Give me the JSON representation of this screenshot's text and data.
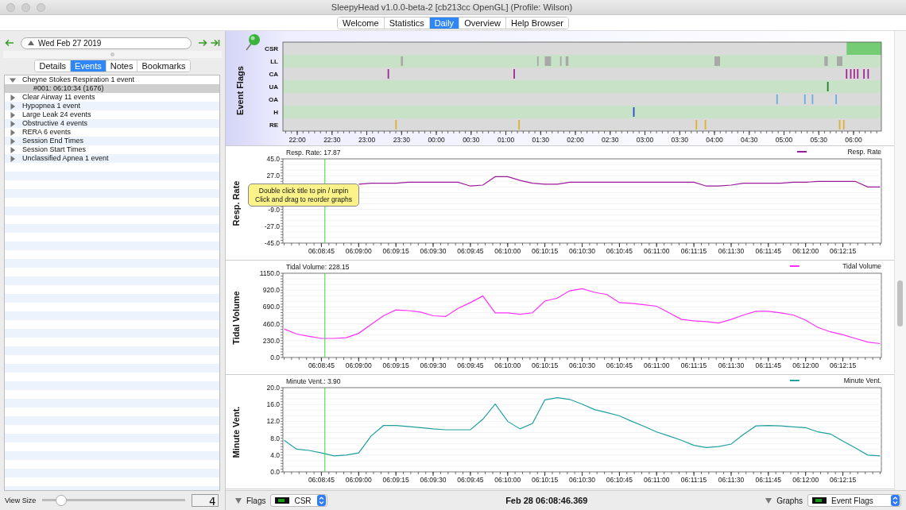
{
  "window": {
    "title": "SleepyHead v1.0.0-beta-2 [cb213cc OpenGL] (Profile: Wilson)"
  },
  "tabs": [
    {
      "label": "Welcome",
      "selected": false
    },
    {
      "label": "Statistics",
      "selected": false
    },
    {
      "label": "Daily",
      "selected": true
    },
    {
      "label": "Overview",
      "selected": false
    },
    {
      "label": "Help Browser",
      "selected": false
    }
  ],
  "sidebar": {
    "date": "Wed Feb 27 2019",
    "tabs": [
      {
        "label": "Details",
        "selected": false
      },
      {
        "label": "Events",
        "selected": true
      },
      {
        "label": "Notes",
        "selected": false
      },
      {
        "label": "Bookmarks",
        "selected": false
      }
    ],
    "events": [
      {
        "label": "Cheyne Stokes Respiration 1 event",
        "expanded": true,
        "children": [
          {
            "label": "#001: 06:10:34 (1676)",
            "selected": true
          }
        ]
      },
      {
        "label": "Clear Airway 11 events",
        "expanded": false
      },
      {
        "label": "Hypopnea 1 event",
        "expanded": false
      },
      {
        "label": "Large Leak 24 events",
        "expanded": false
      },
      {
        "label": "Obstructive 4 events",
        "expanded": false
      },
      {
        "label": "RERA 6 events",
        "expanded": false
      },
      {
        "label": "Session End Times",
        "expanded": false
      },
      {
        "label": "Session Start Times",
        "expanded": false
      },
      {
        "label": "Unclassified Apnea 1 event",
        "expanded": false
      }
    ],
    "view_size": {
      "label": "View Size",
      "level": 0.13,
      "value": "4"
    }
  },
  "graphs": [
    {
      "kind": "flags",
      "title": "Event Flags",
      "rows": [
        {
          "name": "CSR",
          "color": "#74cc74"
        },
        {
          "name": "LL",
          "color": "#a8a8a8"
        },
        {
          "name": "CA",
          "color": "#9c2a90"
        },
        {
          "name": "UA",
          "color": "#2a7a2a"
        },
        {
          "name": "OA",
          "color": "#66aee0"
        },
        {
          "name": "H",
          "color": "#2848d0"
        },
        {
          "name": "RE",
          "color": "#e0b030"
        }
      ],
      "time_labels": [
        "22:00",
        "22:30",
        "23:00",
        "23:30",
        "00:00",
        "00:30",
        "01:00",
        "01:30",
        "02:00",
        "02:30",
        "03:00",
        "03:30",
        "04:00",
        "04:30",
        "05:00",
        "05:30",
        "06:00"
      ]
    },
    {
      "kind": "line",
      "readout": "Resp. Rate: 17.87",
      "tooltip": [
        "Double click title to pin / unpin",
        "Click and drag to reorder graphs"
      ],
      "chart_data": {
        "type": "line",
        "ylabel": "Resp. Rate",
        "ylim": [
          -45,
          45
        ],
        "grid": true,
        "yticks": [
          {
            "value": 45,
            "label": "45.0"
          },
          {
            "value": 27,
            "label": "27.0"
          },
          {
            "value": -9,
            "label": "-9.0"
          },
          {
            "value": -27,
            "label": "-27.0"
          },
          {
            "value": -45,
            "label": "-45.0"
          }
        ],
        "categories": [
          null,
          null,
          null,
          "06:08:45",
          null,
          null,
          "06:09:00",
          null,
          null,
          "06:09:15",
          null,
          null,
          "06:09:30",
          null,
          null,
          "06:09:45",
          null,
          null,
          "06:10:00",
          null,
          null,
          "06:10:15",
          null,
          null,
          "06:10:30",
          null,
          null,
          "06:10:45",
          null,
          null,
          "06:11:00",
          null,
          null,
          "06:11:15",
          null,
          null,
          "06:11:30",
          null,
          null,
          "06:11:45",
          null,
          null,
          "06:12:00",
          null,
          null,
          "06:12:15",
          null,
          null,
          null
        ],
        "series": [
          {
            "name": "Resp. Rate",
            "color": "#9c1a9c",
            "values": [
              null,
              null,
              null,
              null,
              null,
              null,
              18,
              19,
              19,
              19,
              20,
              20,
              20,
              20,
              20,
              16,
              17,
              26,
              26,
              22,
              19,
              18,
              18,
              20,
              20,
              20,
              20,
              20,
              20,
              20,
              20,
              20,
              20,
              20,
              16,
              16,
              17,
              19,
              19,
              19,
              19,
              20,
              20,
              21,
              21,
              21,
              21,
              15,
              15
            ]
          }
        ]
      }
    },
    {
      "kind": "line",
      "readout": "Tidal Volume: 228.15",
      "chart_data": {
        "type": "line",
        "ylabel": "Tidal Volume",
        "ylim": [
          0,
          1150
        ],
        "grid": true,
        "yticks": [
          {
            "value": 1150,
            "label": "1150.0"
          },
          {
            "value": 920,
            "label": "920.0"
          },
          {
            "value": 690,
            "label": "690.0"
          },
          {
            "value": 460,
            "label": "460.0"
          },
          {
            "value": 230,
            "label": "230.0"
          },
          {
            "value": 0,
            "label": "0.0"
          }
        ],
        "categories": [
          null,
          null,
          null,
          "06:08:45",
          null,
          null,
          "06:09:00",
          null,
          null,
          "06:09:15",
          null,
          null,
          "06:09:30",
          null,
          null,
          "06:09:45",
          null,
          null,
          "06:10:00",
          null,
          null,
          "06:10:15",
          null,
          null,
          "06:10:30",
          null,
          null,
          "06:10:45",
          null,
          null,
          "06:11:00",
          null,
          null,
          "06:11:15",
          null,
          null,
          "06:11:30",
          null,
          null,
          "06:11:45",
          null,
          null,
          "06:12:00",
          null,
          null,
          "06:12:15",
          null,
          null,
          null
        ],
        "series": [
          {
            "name": "Tidal Volume",
            "color": "#ff30ff",
            "values": [
              390,
              320,
              290,
              260,
              260,
              270,
              330,
              450,
              570,
              650,
              640,
              620,
              570,
              560,
              670,
              750,
              840,
              610,
              610,
              590,
              610,
              770,
              810,
              910,
              940,
              890,
              860,
              750,
              740,
              720,
              700,
              610,
              520,
              500,
              490,
              470,
              520,
              580,
              630,
              630,
              610,
              580,
              510,
              410,
              350,
              310,
              260,
              210,
              190
            ]
          }
        ]
      }
    },
    {
      "kind": "line",
      "readout": "Minute Vent.: 3.90",
      "chart_data": {
        "type": "line",
        "ylabel": "Minute Vent.",
        "ylim": [
          0,
          20
        ],
        "grid": true,
        "yticks": [
          {
            "value": 20,
            "label": "20.0"
          },
          {
            "value": 16,
            "label": "16.0"
          },
          {
            "value": 12,
            "label": "12.0"
          },
          {
            "value": 8,
            "label": "8.0"
          },
          {
            "value": 4,
            "label": "4.0"
          },
          {
            "value": 0,
            "label": "0.0"
          }
        ],
        "categories": [
          null,
          null,
          null,
          "06:08:45",
          null,
          null,
          "06:09:00",
          null,
          null,
          "06:09:15",
          null,
          null,
          "06:09:30",
          null,
          null,
          "06:09:45",
          null,
          null,
          "06:10:00",
          null,
          null,
          "06:10:15",
          null,
          null,
          "06:10:30",
          null,
          null,
          "06:10:45",
          null,
          null,
          "06:11:00",
          null,
          null,
          "06:11:15",
          null,
          null,
          "06:11:30",
          null,
          null,
          "06:11:45",
          null,
          null,
          "06:12:00",
          null,
          null,
          "06:12:15",
          null,
          null,
          null
        ],
        "series": [
          {
            "name": "Minute Vent.",
            "color": "#20a0a0",
            "values": [
              7.5,
              5.4,
              5.1,
              4.5,
              3.8,
              4,
              4.5,
              8.5,
              11,
              11,
              10.8,
              10.5,
              10.2,
              10,
              10,
              10,
              12.5,
              16.1,
              12,
              10.2,
              11.5,
              17.1,
              17.6,
              17.2,
              16.1,
              14.8,
              14.1,
              13.3,
              12,
              10.8,
              9.5,
              8.5,
              7.5,
              6.3,
              5.8,
              6,
              6.6,
              8.9,
              10.9,
              11,
              10.9,
              10.7,
              10.5,
              9.5,
              9,
              7.3,
              5.7,
              4,
              3.8
            ]
          }
        ]
      }
    }
  ],
  "bottom_bar": {
    "flags_label": "Flags",
    "flags_value": "CSR",
    "time": "Feb 28 06:08:46.369",
    "graphs_label": "Graphs",
    "graphs_value": "Event Flags"
  }
}
